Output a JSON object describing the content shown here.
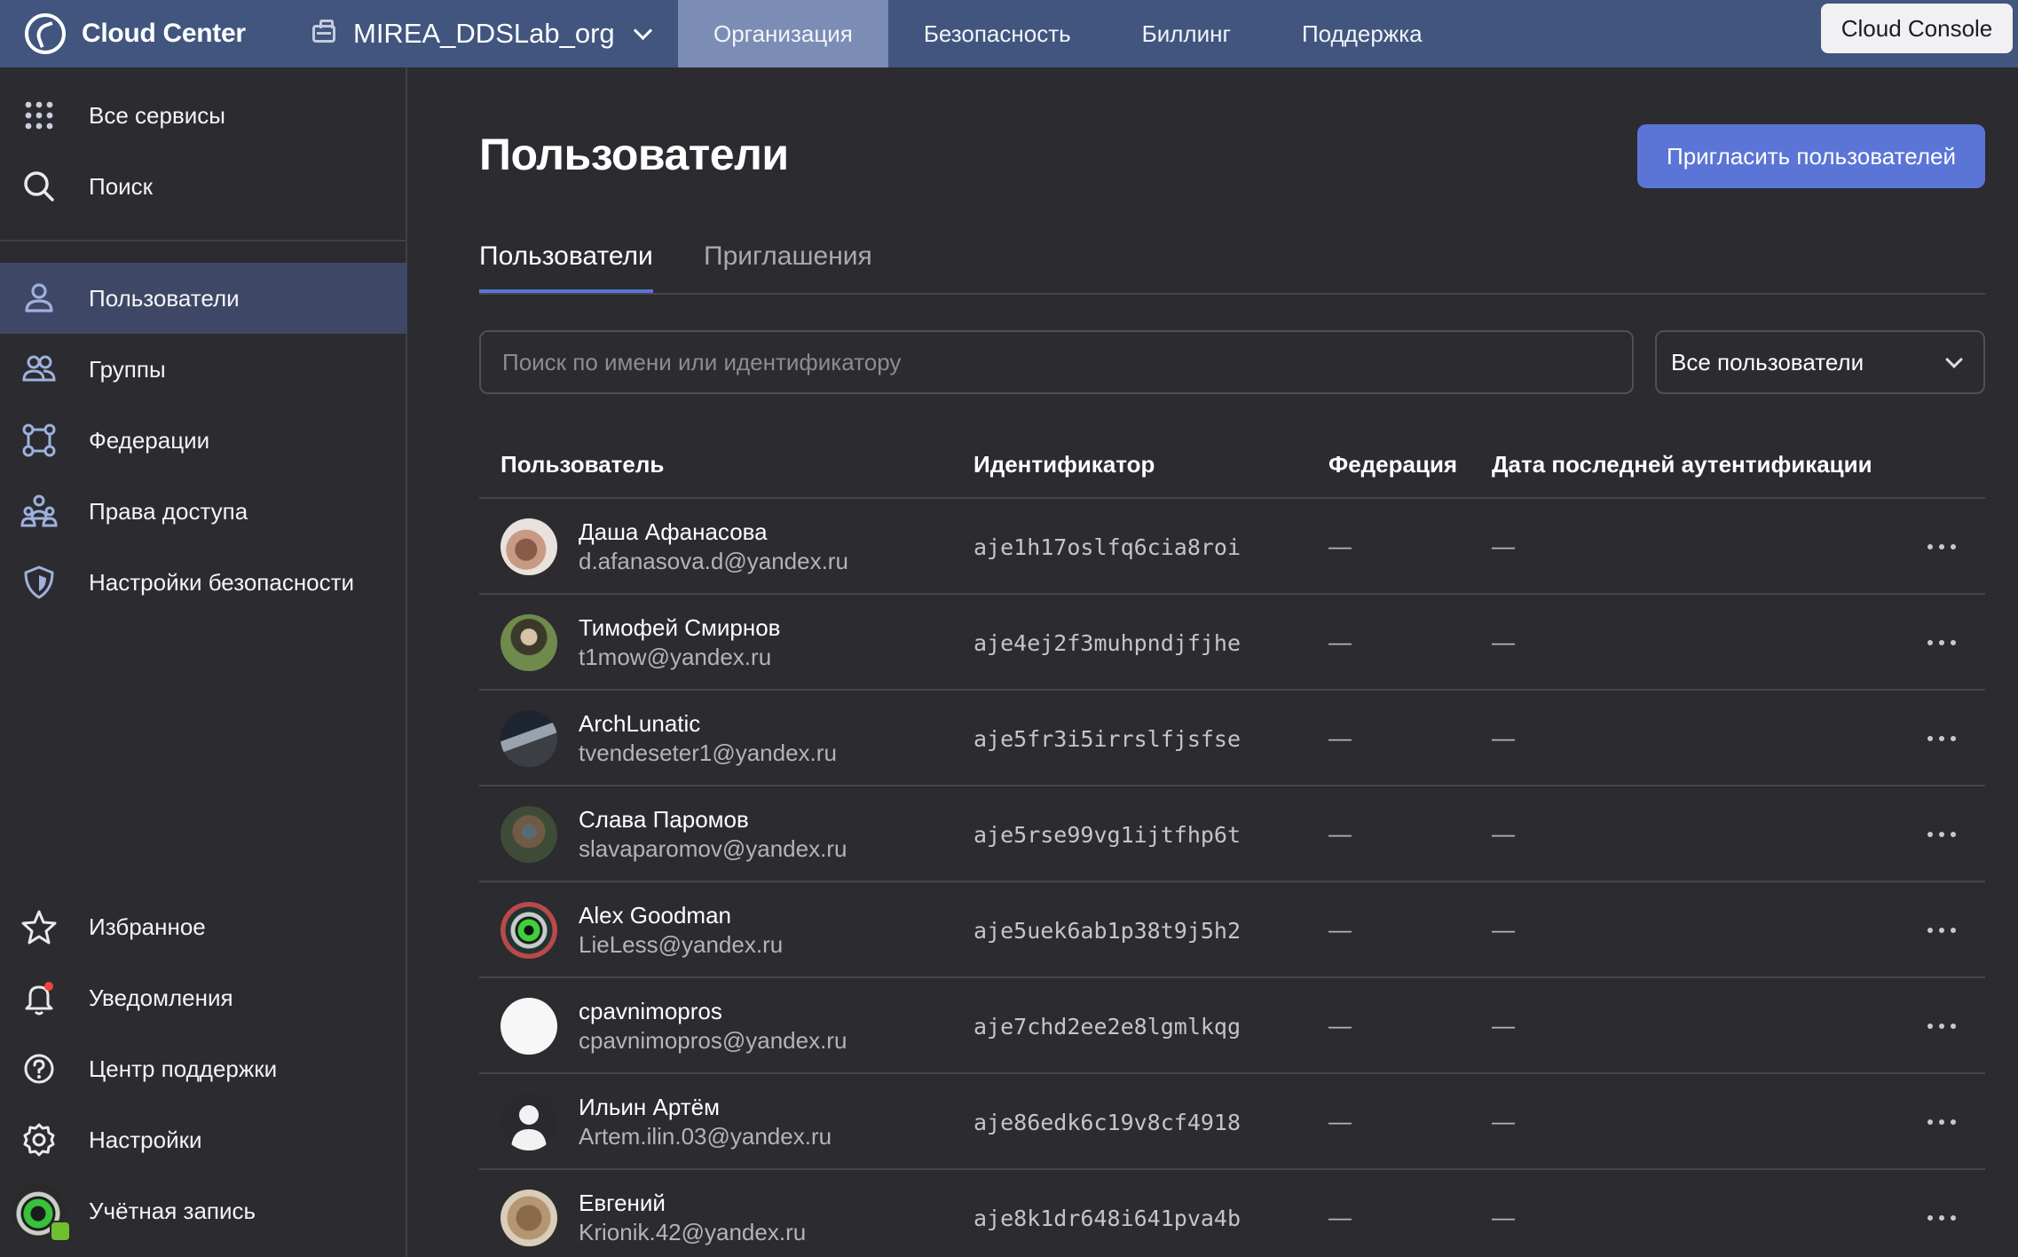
{
  "topbar": {
    "brand": "Cloud Center",
    "org_name": "MIREA_DDSLab_org",
    "nav": [
      {
        "label": "Организация",
        "active": true
      },
      {
        "label": "Безопасность",
        "active": false
      },
      {
        "label": "Биллинг",
        "active": false
      },
      {
        "label": "Поддержка",
        "active": false
      }
    ],
    "console_button": "Cloud Console"
  },
  "sidebar": {
    "top_items": [
      {
        "label": "Все сервисы",
        "icon": "grid-icon"
      },
      {
        "label": "Поиск",
        "icon": "search-icon"
      }
    ],
    "items": [
      {
        "label": "Пользователи",
        "icon": "user-icon",
        "active": true
      },
      {
        "label": "Группы",
        "icon": "group-icon",
        "active": false
      },
      {
        "label": "Федерации",
        "icon": "federation-icon",
        "active": false
      },
      {
        "label": "Права доступа",
        "icon": "access-rights-icon",
        "active": false
      },
      {
        "label": "Настройки безопасности",
        "icon": "shield-icon",
        "active": false
      }
    ],
    "bottom_items": [
      {
        "label": "Избранное",
        "icon": "star-icon"
      },
      {
        "label": "Уведомления",
        "icon": "bell-icon"
      },
      {
        "label": "Центр поддержки",
        "icon": "help-icon"
      },
      {
        "label": "Настройки",
        "icon": "gear-icon"
      },
      {
        "label": "Учётная запись",
        "icon": "account-avatar"
      }
    ]
  },
  "main": {
    "title": "Пользователи",
    "invite_button": "Пригласить пользователей",
    "tabs": [
      {
        "label": "Пользователи",
        "active": true
      },
      {
        "label": "Приглашения",
        "active": false
      }
    ],
    "search": {
      "placeholder": "Поиск по имени или идентификатору",
      "value": ""
    },
    "filter": {
      "selected": "Все пользователи"
    },
    "table": {
      "columns": [
        "Пользователь",
        "Идентификатор",
        "Федерация",
        "Дата последней аутентификации"
      ],
      "rows": [
        {
          "name": "Даша Афанасова",
          "email": "d.afanasova.d@yandex.ru",
          "id": "aje1h17oslfq6cia8roi",
          "federation": "—",
          "last_auth": "—"
        },
        {
          "name": "Тимофей Смирнов",
          "email": "t1mow@yandex.ru",
          "id": "aje4ej2f3muhpndjfjhe",
          "federation": "—",
          "last_auth": "—"
        },
        {
          "name": "ArchLunatic",
          "email": "tvendeseter1@yandex.ru",
          "id": "aje5fr3i5irrslfjsfse",
          "federation": "—",
          "last_auth": "—"
        },
        {
          "name": "Слава Паромов",
          "email": "slavaparomov@yandex.ru",
          "id": "aje5rse99vg1ijtfhp6t",
          "federation": "—",
          "last_auth": "—"
        },
        {
          "name": "Alex Goodman",
          "email": "LieLess@yandex.ru",
          "id": "aje5uek6ab1p38t9j5h2",
          "federation": "—",
          "last_auth": "—"
        },
        {
          "name": "cpavnimopros",
          "email": "cpavnimopros@yandex.ru",
          "id": "aje7chd2ee2e8lgmlkqg",
          "federation": "—",
          "last_auth": "—"
        },
        {
          "name": "Ильин Артём",
          "email": "Artem.ilin.03@yandex.ru",
          "id": "aje86edk6c19v8cf4918",
          "federation": "—",
          "last_auth": "—"
        },
        {
          "name": "Евгений",
          "email": "Krionik.42@yandex.ru",
          "id": "aje8k1dr648i641pva4b",
          "federation": "—",
          "last_auth": "—"
        }
      ]
    }
  },
  "colors": {
    "topbar": "#41557f",
    "active_nav": "#7b8cb5",
    "accent": "#5b75d6",
    "background": "#2b2b30",
    "sidebar_active": "#3e4866"
  }
}
